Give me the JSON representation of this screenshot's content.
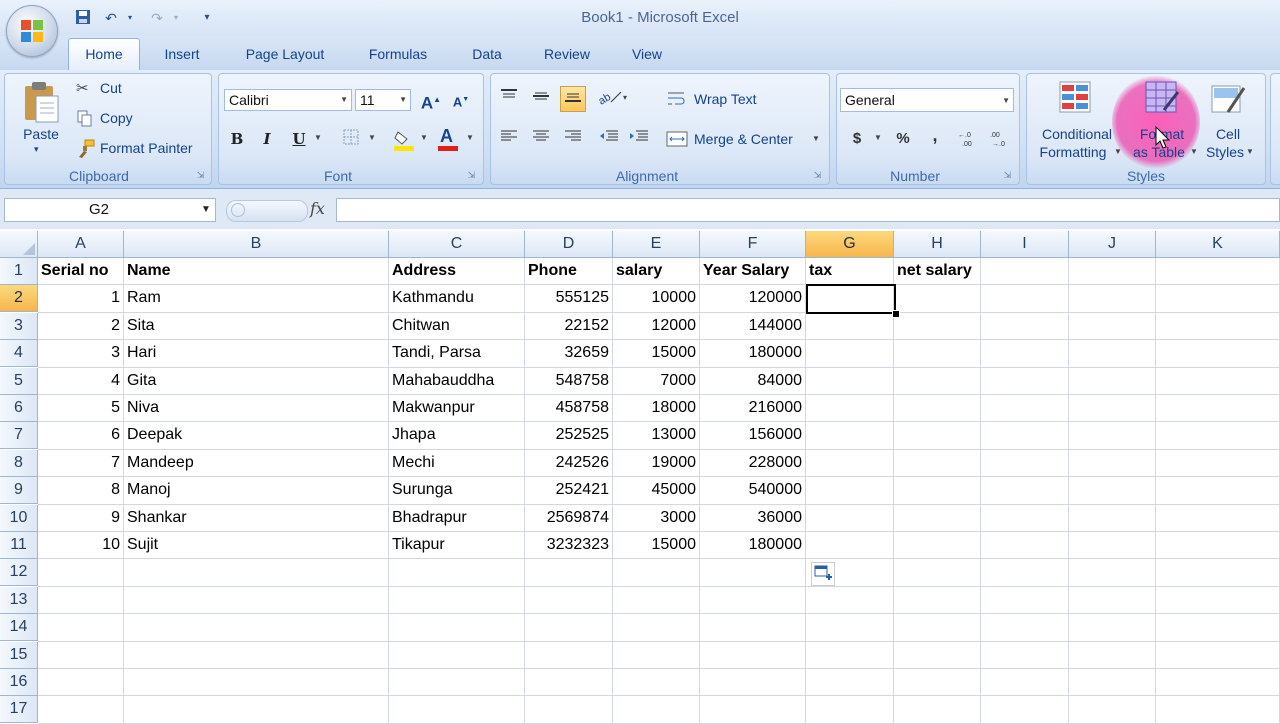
{
  "window": {
    "title": "Book1 - Microsoft Excel"
  },
  "quick_access": {
    "save_icon": "save-icon",
    "undo_icon": "undo-icon",
    "redo_icon": "redo-icon",
    "customize_icon": "customize-qat-icon"
  },
  "tabs": [
    {
      "label": "Home",
      "active": true
    },
    {
      "label": "Insert"
    },
    {
      "label": "Page Layout"
    },
    {
      "label": "Formulas"
    },
    {
      "label": "Data"
    },
    {
      "label": "Review"
    },
    {
      "label": "View"
    }
  ],
  "ribbon": {
    "clipboard": {
      "label": "Clipboard",
      "paste": "Paste",
      "cut": "Cut",
      "copy": "Copy",
      "format_painter": "Format Painter"
    },
    "font": {
      "label": "Font",
      "font_name": "Calibri",
      "font_size": "11",
      "bold": "B",
      "italic": "I",
      "underline": "U",
      "grow": "A",
      "shrink": "A",
      "highlight_color": "#ffe400",
      "font_color": "#e0201b"
    },
    "alignment": {
      "label": "Alignment",
      "wrap_text": "Wrap Text",
      "merge_center": "Merge & Center"
    },
    "number": {
      "label": "Number",
      "format": "General",
      "currency": "$",
      "percent": "%",
      "comma": ","
    },
    "styles": {
      "label": "Styles",
      "conditional_line1": "Conditional",
      "conditional_line2": "Formatting",
      "format_table_line1": "Format",
      "format_table_line2": "as Table",
      "cell_styles_line1": "Cell",
      "cell_styles_line2": "Styles"
    }
  },
  "formula_bar": {
    "name_box": "G2",
    "fx": "fx",
    "formula": ""
  },
  "columns": [
    "A",
    "B",
    "C",
    "D",
    "E",
    "F",
    "G",
    "H",
    "I",
    "J",
    "K"
  ],
  "rows": [
    "1",
    "2",
    "3",
    "4",
    "5",
    "6",
    "7",
    "8",
    "9",
    "10",
    "11",
    "12",
    "13",
    "14",
    "15",
    "16",
    "17"
  ],
  "sheet": {
    "headers": [
      "Serial no",
      "Name",
      "Address",
      "Phone",
      "salary",
      "Year Salary",
      "tax",
      "net salary"
    ],
    "data": [
      [
        "1",
        "Ram",
        "Kathmandu",
        "555125",
        "10000",
        "120000"
      ],
      [
        "2",
        "Sita",
        "Chitwan",
        "22152",
        "12000",
        "144000"
      ],
      [
        "3",
        "Hari",
        "Tandi, Parsa",
        "32659",
        "15000",
        "180000"
      ],
      [
        "4",
        "Gita",
        "Mahabauddha",
        "548758",
        "7000",
        "84000"
      ],
      [
        "5",
        "Niva",
        "Makwanpur",
        "458758",
        "18000",
        "216000"
      ],
      [
        "6",
        "Deepak",
        "Jhapa",
        "252525",
        "13000",
        "156000"
      ],
      [
        "7",
        "Mandeep",
        "Mechi",
        "242526",
        "19000",
        "228000"
      ],
      [
        "8",
        "Manoj",
        "Surunga",
        "252421",
        "45000",
        "540000"
      ],
      [
        "9",
        "Shankar",
        "Bhadrapur",
        "2569874",
        "3000",
        "36000"
      ],
      [
        "10",
        "Sujit",
        "Tikapur",
        "3232323",
        "15000",
        "180000"
      ]
    ],
    "active_cell": "G2"
  }
}
